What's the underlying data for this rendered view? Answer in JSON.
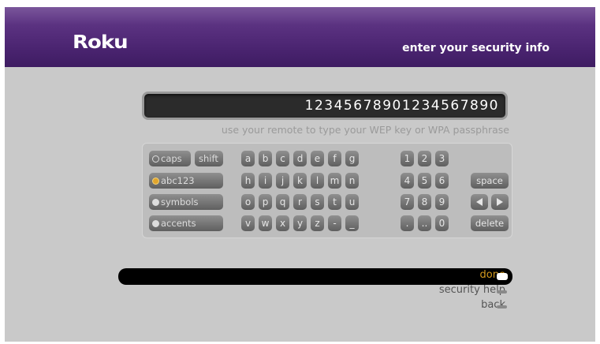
{
  "header": {
    "logo": "Roku",
    "title": "enter your security info"
  },
  "entry": {
    "value": "12345678901234567890"
  },
  "hint": "use your remote to type your WEP key or WPA passphrase",
  "keyboard": {
    "modes": [
      {
        "label": "caps"
      },
      {
        "label": "shift"
      },
      {
        "label": "abc123"
      },
      {
        "label": "symbols"
      },
      {
        "label": "accents"
      }
    ],
    "rows": [
      [
        "a",
        "b",
        "c",
        "d",
        "e",
        "f",
        "g"
      ],
      [
        "h",
        "i",
        "j",
        "k",
        "l",
        "m",
        "n"
      ],
      [
        "o",
        "p",
        "q",
        "r",
        "s",
        "t",
        "u"
      ],
      [
        "v",
        "w",
        "x",
        "y",
        "z",
        "-",
        "_"
      ]
    ],
    "numpad": [
      [
        "1",
        "2",
        "3"
      ],
      [
        "4",
        "5",
        "6"
      ],
      [
        "7",
        "8",
        "9"
      ],
      [
        ".",
        "..",
        "0"
      ]
    ],
    "space_label": "space",
    "delete_label": "delete"
  },
  "menu": {
    "items": [
      {
        "label": "done",
        "selected": true
      },
      {
        "label": "security help"
      },
      {
        "label": "back"
      }
    ]
  },
  "colors": {
    "header_purple": "#4a2470",
    "selected_text": "#d49a1e",
    "menu_text": "#555555"
  }
}
